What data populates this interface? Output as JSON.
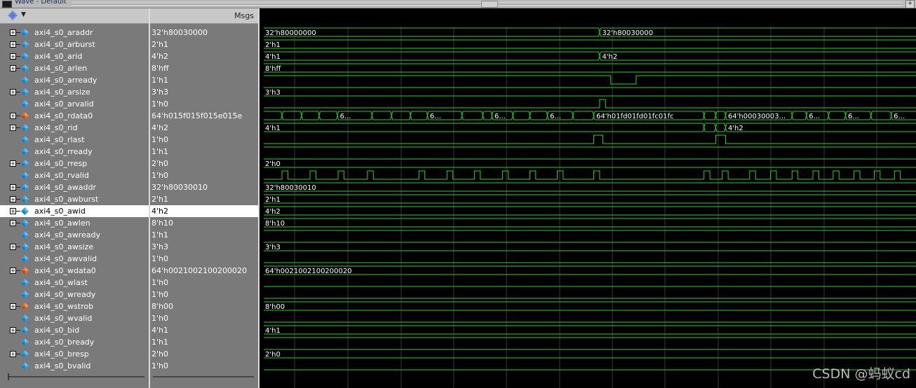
{
  "window": {
    "title": "Wave - Default"
  },
  "values_header": "Msgs",
  "watermark": "CSDN @蚂蚁cd",
  "colors": {
    "wave": "#22d422",
    "grid": "#383838"
  },
  "selected_row": 15,
  "time_range": [
    0,
    100
  ],
  "signals": [
    {
      "name": "axi4_s0_araddr",
      "value": "32'h80030000",
      "bus": true,
      "icon": "blue",
      "segments": [
        {
          "start": 0,
          "end": 51.5,
          "label": "32'h80000000"
        },
        {
          "start": 51.5,
          "end": 100,
          "label": "32'h80030000"
        }
      ]
    },
    {
      "name": "axi4_s0_arburst",
      "value": "2'h1",
      "bus": true,
      "icon": "blue",
      "segments": [
        {
          "start": 0,
          "end": 100,
          "label": "2'h1"
        }
      ]
    },
    {
      "name": "axi4_s0_arid",
      "value": "4'h2",
      "bus": true,
      "icon": "blue",
      "segments": [
        {
          "start": 0,
          "end": 51.5,
          "label": "4'h1"
        },
        {
          "start": 51.5,
          "end": 100,
          "label": "4'h2"
        }
      ]
    },
    {
      "name": "axi4_s0_arlen",
      "value": "8'hff",
      "bus": true,
      "icon": "blue",
      "segments": [
        {
          "start": 0,
          "end": 100,
          "label": "8'hff"
        }
      ]
    },
    {
      "name": "axi4_s0_arready",
      "value": "1'h1",
      "bus": false,
      "icon": "blue",
      "transitions": [
        [
          0,
          1
        ],
        [
          53.2,
          0
        ],
        [
          57.1,
          1
        ]
      ]
    },
    {
      "name": "axi4_s0_arsize",
      "value": "3'h3",
      "bus": true,
      "icon": "blue",
      "segments": [
        {
          "start": 0,
          "end": 100,
          "label": "3'h3"
        }
      ]
    },
    {
      "name": "axi4_s0_arvalid",
      "value": "1'h0",
      "bus": false,
      "icon": "blue",
      "transitions": [
        [
          0,
          0
        ],
        [
          51.5,
          1
        ],
        [
          52.4,
          0
        ]
      ]
    },
    {
      "name": "axi4_s0_rdata0",
      "value": "64'h015f015f015e015e",
      "bus": true,
      "icon": "orange",
      "segments": [
        {
          "start": 0,
          "end": 2.8,
          "label": ""
        },
        {
          "start": 2.8,
          "end": 5.8,
          "label": ""
        },
        {
          "start": 5.8,
          "end": 8.5,
          "label": ""
        },
        {
          "start": 8.5,
          "end": 11.3,
          "label": ""
        },
        {
          "start": 11.3,
          "end": 16.6,
          "label": "6..."
        },
        {
          "start": 16.6,
          "end": 19.6,
          "label": ""
        },
        {
          "start": 19.6,
          "end": 22.5,
          "label": ""
        },
        {
          "start": 22.5,
          "end": 25.1,
          "label": ""
        },
        {
          "start": 25.1,
          "end": 30.4,
          "label": "6..."
        },
        {
          "start": 30.4,
          "end": 33.6,
          "label": ""
        },
        {
          "start": 33.6,
          "end": 35.0,
          "label": ""
        },
        {
          "start": 35.0,
          "end": 38.2,
          "label": "6..."
        },
        {
          "start": 38.2,
          "end": 40.8,
          "label": ""
        },
        {
          "start": 40.8,
          "end": 43.5,
          "label": ""
        },
        {
          "start": 43.5,
          "end": 47.4,
          "label": "6..."
        },
        {
          "start": 47.4,
          "end": 50.6,
          "label": ""
        },
        {
          "start": 50.6,
          "end": 67.5,
          "label": "64'h01fd01fd01fc01fc"
        },
        {
          "start": 67.5,
          "end": 69.3,
          "label": ""
        },
        {
          "start": 69.3,
          "end": 70.8,
          "label": ""
        },
        {
          "start": 70.8,
          "end": 81.0,
          "label": "64'h00030003..."
        },
        {
          "start": 81.0,
          "end": 83.2,
          "label": ""
        },
        {
          "start": 83.2,
          "end": 86.6,
          "label": "6..."
        },
        {
          "start": 86.6,
          "end": 89.2,
          "label": ""
        },
        {
          "start": 89.2,
          "end": 93.1,
          "label": "6..."
        },
        {
          "start": 93.1,
          "end": 96.2,
          "label": ""
        },
        {
          "start": 96.2,
          "end": 100,
          "label": "6..."
        }
      ]
    },
    {
      "name": "axi4_s0_rid",
      "value": "4'h2",
      "bus": true,
      "icon": "blue",
      "segments": [
        {
          "start": 0,
          "end": 67.5,
          "label": "4'h1"
        },
        {
          "start": 67.5,
          "end": 69.3,
          "label": ""
        },
        {
          "start": 69.3,
          "end": 70.8,
          "label": ""
        },
        {
          "start": 70.8,
          "end": 100,
          "label": "4'h2"
        }
      ]
    },
    {
      "name": "axi4_s0_rlast",
      "value": "1'h0",
      "bus": false,
      "icon": "blue",
      "transitions": [
        [
          0,
          0
        ],
        [
          50.6,
          1
        ],
        [
          52.0,
          0
        ],
        [
          69.3,
          1
        ],
        [
          70.8,
          0
        ]
      ]
    },
    {
      "name": "axi4_s0_rready",
      "value": "1'h1",
      "bus": false,
      "icon": "blue",
      "transitions": [
        [
          0,
          1
        ]
      ]
    },
    {
      "name": "axi4_s0_rresp",
      "value": "2'h0",
      "bus": true,
      "icon": "blue",
      "segments": [
        {
          "start": 0,
          "end": 100,
          "label": "2'h0"
        }
      ]
    },
    {
      "name": "axi4_s0_rvalid",
      "value": "1'h0",
      "bus": false,
      "icon": "blue",
      "transitions": [
        [
          0,
          0
        ],
        [
          2.8,
          1
        ],
        [
          3.7,
          0
        ],
        [
          7.1,
          1
        ],
        [
          8.0,
          0
        ],
        [
          11.4,
          1
        ],
        [
          12.3,
          0
        ],
        [
          15.9,
          1
        ],
        [
          16.8,
          0
        ],
        [
          23.8,
          1
        ],
        [
          24.7,
          0
        ],
        [
          28.1,
          1
        ],
        [
          29.0,
          0
        ],
        [
          32.3,
          1
        ],
        [
          33.2,
          0
        ],
        [
          36.6,
          1
        ],
        [
          37.5,
          0
        ],
        [
          40.8,
          1
        ],
        [
          41.7,
          0
        ],
        [
          45.0,
          1
        ],
        [
          45.9,
          0
        ],
        [
          50.6,
          1
        ],
        [
          51.5,
          0
        ],
        [
          67.5,
          1
        ],
        [
          68.4,
          0
        ],
        [
          70.3,
          1
        ],
        [
          71.2,
          0
        ],
        [
          74.5,
          1
        ],
        [
          75.4,
          0
        ],
        [
          77.7,
          1
        ],
        [
          78.6,
          0
        ],
        [
          81.0,
          1
        ],
        [
          81.9,
          0
        ],
        [
          84.2,
          1
        ],
        [
          85.1,
          0
        ],
        [
          87.3,
          1
        ],
        [
          88.2,
          0
        ],
        [
          90.5,
          1
        ],
        [
          91.4,
          0
        ],
        [
          93.6,
          1
        ],
        [
          94.5,
          0
        ],
        [
          96.7,
          1
        ],
        [
          97.6,
          0
        ]
      ]
    },
    {
      "name": "axi4_s0_awaddr",
      "value": "32'h80030010",
      "bus": true,
      "icon": "blue",
      "segments": [
        {
          "start": 0,
          "end": 100,
          "label": "32'h80030010"
        }
      ]
    },
    {
      "name": "axi4_s0_awburst",
      "value": "2'h1",
      "bus": true,
      "icon": "blue",
      "segments": [
        {
          "start": 0,
          "end": 100,
          "label": "2'h1"
        }
      ]
    },
    {
      "name": "axi4_s0_awid",
      "value": "4'h2",
      "bus": true,
      "icon": "blue",
      "segments": [
        {
          "start": 0,
          "end": 100,
          "label": "4'h2"
        }
      ]
    },
    {
      "name": "axi4_s0_awlen",
      "value": "8'h10",
      "bus": true,
      "icon": "blue",
      "segments": [
        {
          "start": 0,
          "end": 100,
          "label": "8'h10"
        }
      ]
    },
    {
      "name": "axi4_s0_awready",
      "value": "1'h1",
      "bus": false,
      "icon": "blue",
      "transitions": [
        [
          0,
          1
        ]
      ]
    },
    {
      "name": "axi4_s0_awsize",
      "value": "3'h3",
      "bus": true,
      "icon": "blue",
      "segments": [
        {
          "start": 0,
          "end": 100,
          "label": "3'h3"
        }
      ]
    },
    {
      "name": "axi4_s0_awvalid",
      "value": "1'h0",
      "bus": false,
      "icon": "blue",
      "transitions": [
        [
          0,
          0
        ]
      ]
    },
    {
      "name": "axi4_s0_wdata0",
      "value": "64'h0021002100200020",
      "bus": true,
      "icon": "orange",
      "segments": [
        {
          "start": 0,
          "end": 100,
          "label": "64'h0021002100200020"
        }
      ]
    },
    {
      "name": "axi4_s0_wlast",
      "value": "1'h0",
      "bus": false,
      "icon": "blue",
      "transitions": [
        [
          0,
          0
        ]
      ]
    },
    {
      "name": "axi4_s0_wready",
      "value": "1'h0",
      "bus": false,
      "icon": "blue",
      "transitions": [
        [
          0,
          0
        ]
      ]
    },
    {
      "name": "axi4_s0_wstrob",
      "value": "8'h00",
      "bus": true,
      "icon": "orange",
      "segments": [
        {
          "start": 0,
          "end": 100,
          "label": "8'h00"
        }
      ]
    },
    {
      "name": "axi4_s0_wvalid",
      "value": "1'h0",
      "bus": false,
      "icon": "blue",
      "transitions": [
        [
          0,
          0
        ]
      ]
    },
    {
      "name": "axi4_s0_bid",
      "value": "4'h1",
      "bus": true,
      "icon": "blue",
      "segments": [
        {
          "start": 0,
          "end": 100,
          "label": "4'h1"
        }
      ]
    },
    {
      "name": "axi4_s0_bready",
      "value": "1'h1",
      "bus": false,
      "icon": "blue",
      "transitions": [
        [
          0,
          1
        ]
      ]
    },
    {
      "name": "axi4_s0_bresp",
      "value": "2'h0",
      "bus": true,
      "icon": "blue",
      "segments": [
        {
          "start": 0,
          "end": 100,
          "label": "2'h0"
        }
      ]
    },
    {
      "name": "axi4_s0_bvalid",
      "value": "1'h0",
      "bus": false,
      "icon": "blue",
      "transitions": [
        [
          0,
          0
        ]
      ]
    }
  ]
}
